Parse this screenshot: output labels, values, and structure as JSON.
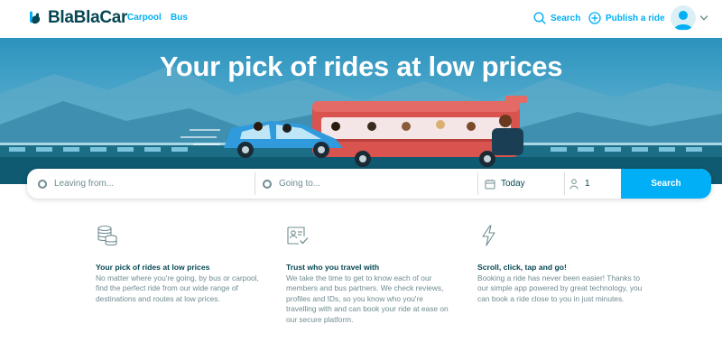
{
  "header": {
    "logo_text": "BlaBlaCar",
    "nav": {
      "carpool": "Carpool",
      "bus": "Bus"
    },
    "search_label": "Search",
    "publish_label": "Publish a ride"
  },
  "hero": {
    "title": "Your pick of rides at low prices"
  },
  "search_form": {
    "from_placeholder": "Leaving from...",
    "to_placeholder": "Going to...",
    "date_value": "Today",
    "passengers_value": "1",
    "submit_label": "Search"
  },
  "features": [
    {
      "icon": "coins-icon",
      "title": "Your pick of rides at low prices",
      "body": "No matter where you're going, by bus or carpool, find the perfect ride from our wide range of destinations and routes at low prices."
    },
    {
      "icon": "id-card-check-icon",
      "title": "Trust who you travel with",
      "body": "We take the time to get to know each of our members and bus partners. We check reviews, profiles and IDs, so you know who you're travelling with and can book your ride at ease on our secure platform."
    },
    {
      "icon": "lightning-icon",
      "title": "Scroll, click, tap and go!",
      "body": "Booking a ride has never been easier! Thanks to our simple app powered by great technology, you can book a ride close to you in just minutes."
    }
  ],
  "colors": {
    "brand_blue": "#00aff5",
    "text_dark": "#054752",
    "text_muted": "#708c91"
  }
}
